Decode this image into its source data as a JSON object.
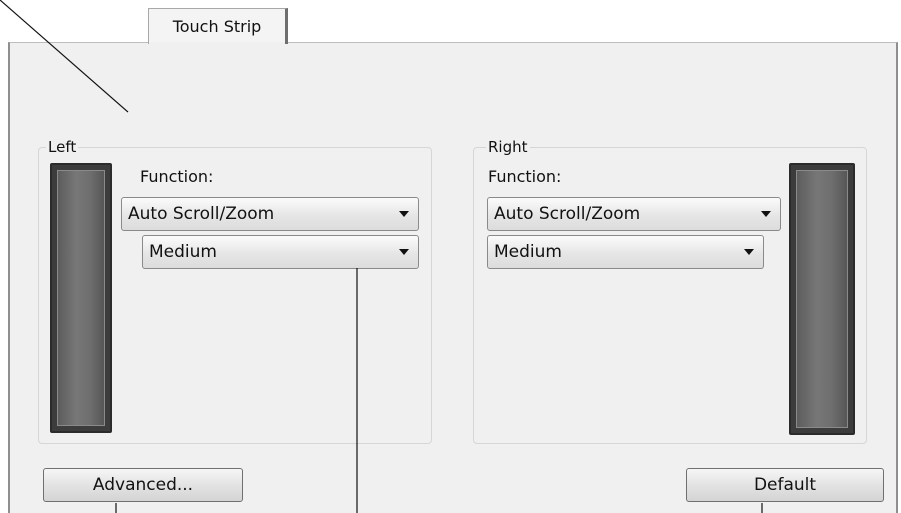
{
  "tab": {
    "label": "Touch Strip"
  },
  "left": {
    "group_title": "Left",
    "function_label": "Function:",
    "function_value": "Auto Scroll/Zoom",
    "speed_value": "Medium"
  },
  "right": {
    "group_title": "Right",
    "function_label": "Function:",
    "function_value": "Auto Scroll/Zoom",
    "speed_value": "Medium"
  },
  "buttons": {
    "advanced": "Advanced...",
    "default": "Default"
  },
  "icons": {
    "dropdown_arrow": "chevron-down-icon",
    "strip": "touch-strip-icon"
  }
}
